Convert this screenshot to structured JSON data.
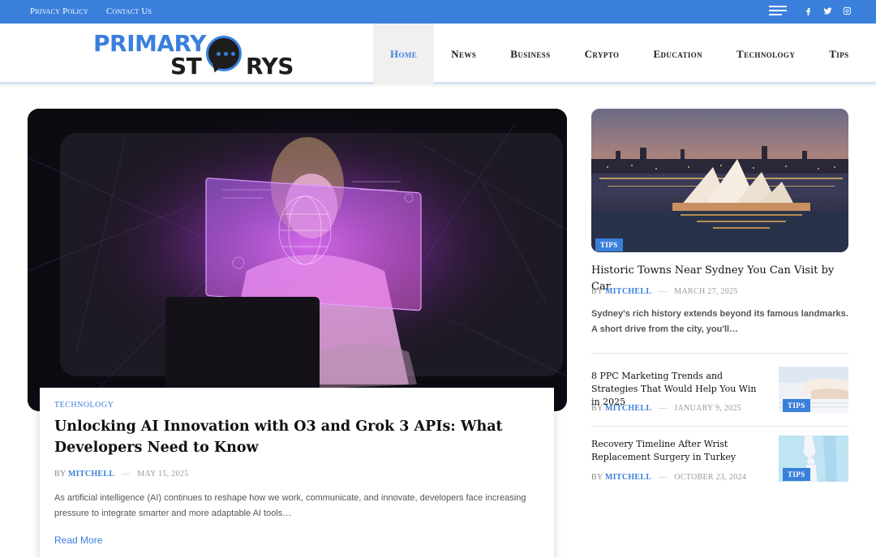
{
  "topbar": {
    "links": [
      "Privacy Policy",
      "Contact Us"
    ],
    "social_icons": [
      "facebook-icon",
      "twitter-icon",
      "instagram-icon"
    ]
  },
  "logo": {
    "line1": "PRIMARY",
    "line2_left": "ST",
    "line2_right": "RYS"
  },
  "nav": {
    "items": [
      "Home",
      "News",
      "Business",
      "Crypto",
      "Education",
      "Technology",
      "Tips"
    ],
    "active": "Home"
  },
  "hero": {
    "category": "Technology",
    "title": "Unlocking AI Innovation with O3 and Grok 3 APIs: What Developers Need to Know",
    "by": "By",
    "author": "Mitchell",
    "date": "May 15, 2025",
    "excerpt": "As artificial intelligence (AI) continues to reshape how we work, communicate, and innovate, developers face increasing pressure to integrate smarter and more adaptable AI tools…",
    "read_more": "Read More"
  },
  "sidebar": {
    "main": {
      "badge": "Tips",
      "title": "Historic Towns Near Sydney You Can Visit by Car",
      "by": "By",
      "author": "Mitchell",
      "date": "March 27, 2025",
      "excerpt": "Sydney's rich history extends beyond its famous landmarks. A short drive from the city, you'll…"
    },
    "items": [
      {
        "title": "8 PPC Marketing Trends and Strategies That Would Help You Win in 2025",
        "by": "By",
        "author": "Mitchell",
        "date": "January 9, 2025",
        "badge": "Tips"
      },
      {
        "title": "Recovery Timeline After Wrist Replacement Surgery in Turkey",
        "by": "By",
        "author": "Mitchell",
        "date": "October 23, 2024",
        "badge": "Tips"
      }
    ]
  },
  "colors": {
    "accent": "#3a7fdb",
    "text": "#111111",
    "muted": "#999999"
  }
}
